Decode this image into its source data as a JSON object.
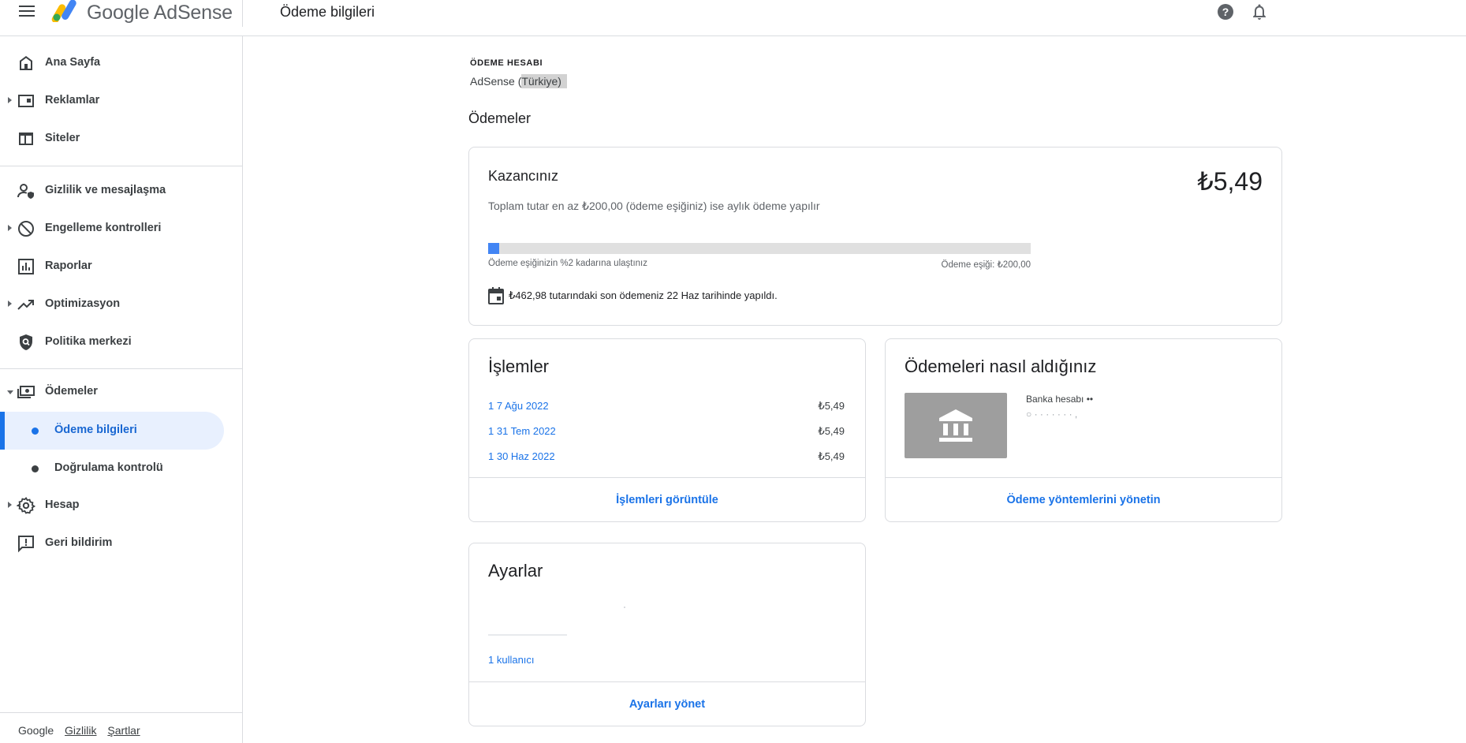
{
  "header": {
    "brand": "Google AdSense",
    "page_title": "Ödeme bilgileri"
  },
  "sidebar": {
    "items": [
      {
        "label": "Ana Sayfa"
      },
      {
        "label": "Reklamlar"
      },
      {
        "label": "Siteler"
      },
      {
        "label": "Gizlilik ve mesajlaşma"
      },
      {
        "label": "Engelleme kontrolleri"
      },
      {
        "label": "Raporlar"
      },
      {
        "label": "Optimizasyon"
      },
      {
        "label": "Politika merkezi"
      },
      {
        "label": "Ödemeler"
      },
      {
        "label": "Hesap"
      },
      {
        "label": "Geri bildirim"
      }
    ],
    "sub_items": [
      {
        "label": "Ödeme bilgileri",
        "active": true
      },
      {
        "label": "Doğrulama kontrolü",
        "active": false
      }
    ],
    "footer": {
      "google": "Google",
      "privacy": "Gizlilik",
      "terms": "Şartlar"
    }
  },
  "account": {
    "label": "ÖDEME HESABI",
    "name_prefix": "AdSense (",
    "name_highlight": "Türkiye)"
  },
  "payments_title": "Ödemeler",
  "earnings": {
    "title": "Kazancınız",
    "amount": "₺5,49",
    "description": "Toplam tutar en az ₺200,00 (ödeme eşiğiniz) ise aylık ödeme yapılır",
    "progress_percent": 2,
    "progress_left": "Ödeme eşiğinizin %2 kadarına ulaştınız",
    "progress_right": "Ödeme eşiği: ₺200,00",
    "last_payment": "₺462,98 tutarındaki son ödemeniz 22 Haz tarihinde yapıldı."
  },
  "transactions": {
    "title": "İşlemler",
    "rows": [
      {
        "date": "1  7 Ağu 2022",
        "amount": "₺5,49"
      },
      {
        "date": "1  31 Tem 2022",
        "amount": "₺5,49"
      },
      {
        "date": "1  30 Haz 2022",
        "amount": "₺5,49"
      }
    ],
    "action": "İşlemleri görüntüle"
  },
  "methods": {
    "title": "Ödemeleri nasıl aldığınız",
    "bank_label": "Banka hesabı ••",
    "bank_mask": "○  ·  ·  ·  ·  ·  ·  ·  ,",
    "action": "Ödeme yöntemlerini yönetin"
  },
  "settings": {
    "title": "Ayarlar",
    "users": "1 kullanıcı",
    "action": "Ayarları yönet"
  },
  "colors": {
    "accent": "#1a73e8",
    "active_bg": "#e8f0fe",
    "progress_fill": "#4285f4",
    "bank_box": "#9e9e9e"
  }
}
